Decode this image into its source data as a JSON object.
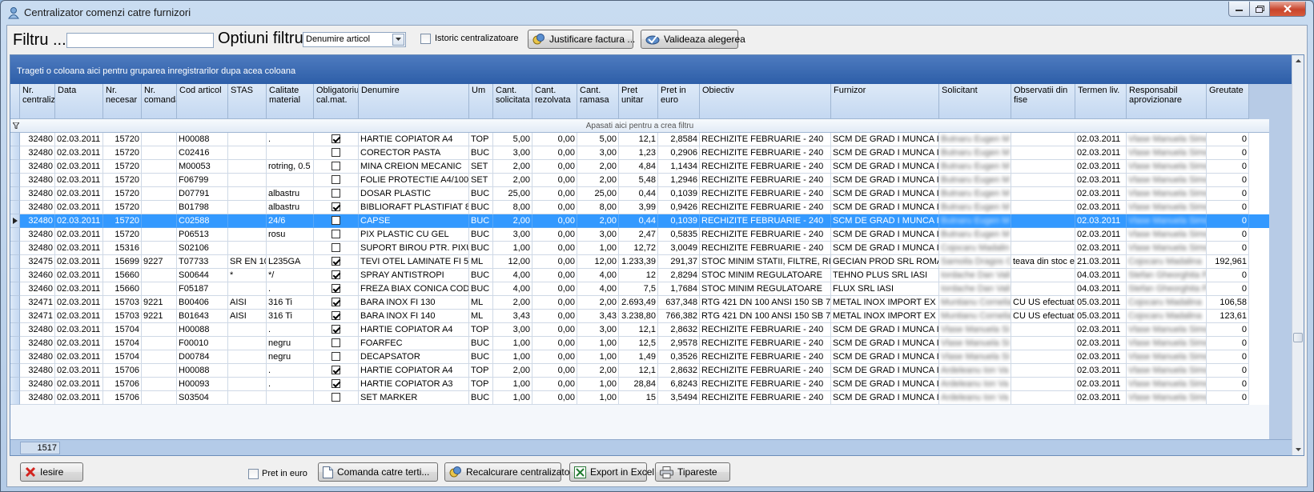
{
  "window": {
    "title": "Centralizator comenzi catre furnizori"
  },
  "toolbar": {
    "filter_label": "Filtru ...",
    "filter_value": "",
    "options_label": "Optiuni filtru",
    "options_selected": "Denumire articol",
    "history_label": "Istoric centralizatoare",
    "justify_label": "Justificare factura ...",
    "validate_label": "Valideaza alegerea"
  },
  "grid": {
    "group_hint": "Trageti o coloana aici pentru gruparea inregistrarilor dupa acea coloana",
    "filter_hint": "Apasati aici pentru a  crea filtru",
    "columns": [
      "Nr. centralizator",
      "Data",
      "Nr. necesar",
      "Nr. comanda",
      "Cod articol",
      "STAS",
      "Calitate material",
      "Obligatoriu cal.mat.",
      "Denumire",
      "Um",
      "Cant. solicitata",
      "Cant. rezolvata",
      "Cant. ramasa",
      "Pret unitar",
      "Pret in euro",
      "Obiectiv",
      "Furnizor",
      "Solicitant",
      "Observatii din fise",
      "Termen liv.",
      "Responsabil aprovizionare",
      "Greutate"
    ],
    "rows": [
      {
        "nr": "32480",
        "data": "02.03.2011",
        "nec": "15720",
        "com": "",
        "cod": "H00088",
        "stas": "",
        "cal": ".",
        "obl": true,
        "den": "HARTIE COPIATOR A4",
        "um": "TOP",
        "sol": "5,00",
        "rez": "0,00",
        "ram": "5,00",
        "pu": "12,1",
        "pe": "2,8584",
        "obi": "RECHIZITE FEBRUARIE - 240",
        "fur": "SCM DE GRAD I MUNCA I",
        "sli": "Butnaru Eugen M",
        "obs": "",
        "ter": "02.03.2011",
        "res": "Vlase Manuela Simona",
        "gre": "0"
      },
      {
        "nr": "32480",
        "data": "02.03.2011",
        "nec": "15720",
        "com": "",
        "cod": "C02416",
        "stas": "",
        "cal": "",
        "obl": false,
        "den": "CORECTOR PASTA",
        "um": "BUC",
        "sol": "3,00",
        "rez": "0,00",
        "ram": "3,00",
        "pu": "1,23",
        "pe": "0,2906",
        "obi": "RECHIZITE FEBRUARIE - 240",
        "fur": "SCM DE GRAD I MUNCA I",
        "sli": "Butnaru Eugen M",
        "obs": "",
        "ter": "02.03.2011",
        "res": "Vlase Manuela Simona",
        "gre": "0"
      },
      {
        "nr": "32480",
        "data": "02.03.2011",
        "nec": "15720",
        "com": "",
        "cod": "M00053",
        "stas": "",
        "cal": "rotring, 0.5 m",
        "obl": false,
        "den": "MINA CREION MECANIC",
        "um": "SET",
        "sol": "2,00",
        "rez": "0,00",
        "ram": "2,00",
        "pu": "4,84",
        "pe": "1,1434",
        "obi": "RECHIZITE FEBRUARIE - 240",
        "fur": "SCM DE GRAD I MUNCA I",
        "sli": "Butnaru Eugen M",
        "obs": "",
        "ter": "02.03.2011",
        "res": "Vlase Manuela Simona",
        "gre": "0"
      },
      {
        "nr": "32480",
        "data": "02.03.2011",
        "nec": "15720",
        "com": "",
        "cod": "F06799",
        "stas": "",
        "cal": "",
        "obl": false,
        "den": "FOLIE PROTECTIE A4/100",
        "um": "SET",
        "sol": "2,00",
        "rez": "0,00",
        "ram": "2,00",
        "pu": "5,48",
        "pe": "1,2946",
        "obi": "RECHIZITE FEBRUARIE - 240",
        "fur": "SCM DE GRAD I MUNCA I",
        "sli": "Butnaru Eugen M",
        "obs": "",
        "ter": "02.03.2011",
        "res": "Vlase Manuela Simona",
        "gre": "0"
      },
      {
        "nr": "32480",
        "data": "02.03.2011",
        "nec": "15720",
        "com": "",
        "cod": "D07791",
        "stas": "",
        "cal": "albastru",
        "obl": false,
        "den": "DOSAR PLASTIC",
        "um": "BUC",
        "sol": "25,00",
        "rez": "0,00",
        "ram": "25,00",
        "pu": "0,44",
        "pe": "0,1039",
        "obi": "RECHIZITE FEBRUARIE - 240",
        "fur": "SCM DE GRAD I MUNCA I",
        "sli": "Butnaru Eugen M",
        "obs": "",
        "ter": "02.03.2011",
        "res": "Vlase Manuela Simona",
        "gre": "0"
      },
      {
        "nr": "32480",
        "data": "02.03.2011",
        "nec": "15720",
        "com": "",
        "cod": "B01798",
        "stas": "",
        "cal": "albastru",
        "obl": true,
        "den": "BIBLIORAFT PLASTIFIAT 8",
        "um": "BUC",
        "sol": "8,00",
        "rez": "0,00",
        "ram": "8,00",
        "pu": "3,99",
        "pe": "0,9426",
        "obi": "RECHIZITE FEBRUARIE - 240",
        "fur": "SCM DE GRAD I MUNCA I",
        "sli": "Butnaru Eugen M",
        "obs": "",
        "ter": "02.03.2011",
        "res": "Vlase Manuela Simona",
        "gre": "0"
      },
      {
        "nr": "32480",
        "data": "02.03.2011",
        "nec": "15720",
        "com": "",
        "cod": "C02588",
        "stas": "",
        "cal": "24/6",
        "obl": false,
        "den": "CAPSE",
        "um": "BUC",
        "sol": "2,00",
        "rez": "0,00",
        "ram": "2,00",
        "pu": "0,44",
        "pe": "0,1039",
        "obi": "RECHIZITE FEBRUARIE - 240",
        "fur": "SCM DE GRAD I MUNCA I",
        "sli": "Butnaru Eugen M",
        "obs": "",
        "ter": "02.03.2011",
        "res": "Vlase Manuela Simona",
        "gre": "0",
        "sel": true
      },
      {
        "nr": "32480",
        "data": "02.03.2011",
        "nec": "15720",
        "com": "",
        "cod": "P06513",
        "stas": "",
        "cal": "rosu",
        "obl": false,
        "den": "PIX PLASTIC CU GEL",
        "um": "BUC",
        "sol": "3,00",
        "rez": "0,00",
        "ram": "3,00",
        "pu": "2,47",
        "pe": "0,5835",
        "obi": "RECHIZITE FEBRUARIE - 240",
        "fur": "SCM DE GRAD I MUNCA I",
        "sli": "Butnaru Eugen M",
        "obs": "",
        "ter": "02.03.2011",
        "res": "Vlase Manuela Simona",
        "gre": "0"
      },
      {
        "nr": "32480",
        "data": "02.03.2011",
        "nec": "15316",
        "com": "",
        "cod": "S02106",
        "stas": "",
        "cal": "",
        "obl": false,
        "den": "SUPORT BIROU PTR. PIXU",
        "um": "BUC",
        "sol": "1,00",
        "rez": "0,00",
        "ram": "1,00",
        "pu": "12,72",
        "pe": "3,0049",
        "obi": "RECHIZITE FEBRUARIE - 240",
        "fur": "SCM DE GRAD I MUNCA I",
        "sli": "Cojocaru Madalin",
        "obs": "",
        "ter": "02.03.2011",
        "res": "Vlase Manuela Simona",
        "gre": "0"
      },
      {
        "nr": "32475",
        "data": "02.03.2011",
        "nec": "15699",
        "com": "9227",
        "cod": "T07733",
        "stas": "SR EN 10",
        "cal": "L235GA",
        "obl": true,
        "den": "TEVI OTEL LAMINATE FI 5",
        "um": "ML",
        "sol": "12,00",
        "rez": "0,00",
        "ram": "12,00",
        "pu": "1.233,39",
        "pe": "291,37",
        "obi": "STOC MINIM STATII, FILTRE, RI",
        "fur": "GECIAN PROD SRL ROMA",
        "sli": "Samoila Dragos C",
        "obs": "teava din stoc e",
        "ter": "21.03.2011",
        "res": "Cojocaru Madalina",
        "gre": "192,961"
      },
      {
        "nr": "32460",
        "data": "02.03.2011",
        "nec": "15660",
        "com": "",
        "cod": "S00644",
        "stas": "*",
        "cal": "*/",
        "obl": true,
        "den": "SPRAY ANTISTROPI",
        "um": "BUC",
        "sol": "4,00",
        "rez": "0,00",
        "ram": "4,00",
        "pu": "12",
        "pe": "2,8294",
        "obi": "STOC MINIM REGULATOARE",
        "fur": "TEHNO PLUS SRL IASI",
        "sli": "Iordache Dan Vali",
        "obs": "",
        "ter": "04.03.2011",
        "res": "Stefan Gheorghita Fl",
        "gre": "0"
      },
      {
        "nr": "32460",
        "data": "02.03.2011",
        "nec": "15660",
        "com": "",
        "cod": "F05187",
        "stas": "",
        "cal": ".",
        "obl": true,
        "den": "FREZA BIAX CONICA COD",
        "um": "BUC",
        "sol": "4,00",
        "rez": "0,00",
        "ram": "4,00",
        "pu": "7,5",
        "pe": "1,7684",
        "obi": "STOC MINIM REGULATOARE",
        "fur": "FLUX SRL IASI",
        "sli": "Iordache Dan Vali",
        "obs": "",
        "ter": "04.03.2011",
        "res": "Stefan Gheorghita Fl",
        "gre": "0"
      },
      {
        "nr": "32471",
        "data": "02.03.2011",
        "nec": "15703",
        "com": "9221",
        "cod": "B00406",
        "stas": "AISI",
        "cal": "316 Ti",
        "obl": true,
        "den": "BARA INOX FI 130",
        "um": "ML",
        "sol": "2,00",
        "rez": "0,00",
        "ram": "2,00",
        "pu": "2.693,49",
        "pe": "637,348",
        "obi": "RTG 421 DN 100 ANSI 150 SB 7",
        "fur": "METAL INOX IMPORT EX",
        "sli": "Muntianu Cornelia",
        "obs": "CU US efectuat",
        "ter": "05.03.2011",
        "res": "Cojocaru Madalina",
        "gre": "106,58"
      },
      {
        "nr": "32471",
        "data": "02.03.2011",
        "nec": "15703",
        "com": "9221",
        "cod": "B01643",
        "stas": "AISI",
        "cal": "316 Ti",
        "obl": true,
        "den": "BARA INOX FI 140",
        "um": "ML",
        "sol": "3,43",
        "rez": "0,00",
        "ram": "3,43",
        "pu": "3.238,80",
        "pe": "766,382",
        "obi": "RTG 421 DN 100 ANSI 150 SB 7",
        "fur": "METAL INOX IMPORT EX",
        "sli": "Muntianu Cornelia",
        "obs": "CU US efectuat",
        "ter": "05.03.2011",
        "res": "Cojocaru Madalina",
        "gre": "123,61"
      },
      {
        "nr": "32480",
        "data": "02.03.2011",
        "nec": "15704",
        "com": "",
        "cod": "H00088",
        "stas": "",
        "cal": ".",
        "obl": true,
        "den": "HARTIE COPIATOR A4",
        "um": "TOP",
        "sol": "3,00",
        "rez": "0,00",
        "ram": "3,00",
        "pu": "12,1",
        "pe": "2,8632",
        "obi": "RECHIZITE FEBRUARIE - 240",
        "fur": "SCM DE GRAD I MUNCA I",
        "sli": "Vlase Manuela Si",
        "obs": "",
        "ter": "02.03.2011",
        "res": "Vlase Manuela Simona",
        "gre": "0"
      },
      {
        "nr": "32480",
        "data": "02.03.2011",
        "nec": "15704",
        "com": "",
        "cod": "F00010",
        "stas": "",
        "cal": "negru",
        "obl": false,
        "den": "FOARFEC",
        "um": "BUC",
        "sol": "1,00",
        "rez": "0,00",
        "ram": "1,00",
        "pu": "12,5",
        "pe": "2,9578",
        "obi": "RECHIZITE FEBRUARIE - 240",
        "fur": "SCM DE GRAD I MUNCA I",
        "sli": "Vlase Manuela Si",
        "obs": "",
        "ter": "02.03.2011",
        "res": "Vlase Manuela Simona",
        "gre": "0"
      },
      {
        "nr": "32480",
        "data": "02.03.2011",
        "nec": "15704",
        "com": "",
        "cod": "D00784",
        "stas": "",
        "cal": "negru",
        "obl": false,
        "den": "DECAPSATOR",
        "um": "BUC",
        "sol": "1,00",
        "rez": "0,00",
        "ram": "1,00",
        "pu": "1,49",
        "pe": "0,3526",
        "obi": "RECHIZITE FEBRUARIE - 240",
        "fur": "SCM DE GRAD I MUNCA I",
        "sli": "Vlase Manuela Si",
        "obs": "",
        "ter": "02.03.2011",
        "res": "Vlase Manuela Simona",
        "gre": "0"
      },
      {
        "nr": "32480",
        "data": "02.03.2011",
        "nec": "15706",
        "com": "",
        "cod": "H00088",
        "stas": "",
        "cal": ".",
        "obl": true,
        "den": "HARTIE COPIATOR A4",
        "um": "TOP",
        "sol": "2,00",
        "rez": "0,00",
        "ram": "2,00",
        "pu": "12,1",
        "pe": "2,8632",
        "obi": "RECHIZITE FEBRUARIE - 240",
        "fur": "SCM DE GRAD I MUNCA I",
        "sli": "Ardeleanu Ion Va",
        "obs": "",
        "ter": "02.03.2011",
        "res": "Vlase Manuela Simona",
        "gre": "0"
      },
      {
        "nr": "32480",
        "data": "02.03.2011",
        "nec": "15706",
        "com": "",
        "cod": "H00093",
        "stas": "",
        "cal": ".",
        "obl": true,
        "den": "HARTIE COPIATOR A3",
        "um": "TOP",
        "sol": "1,00",
        "rez": "0,00",
        "ram": "1,00",
        "pu": "28,84",
        "pe": "6,8243",
        "obi": "RECHIZITE FEBRUARIE - 240",
        "fur": "SCM DE GRAD I MUNCA I",
        "sli": "Ardeleanu Ion Va",
        "obs": "",
        "ter": "02.03.2011",
        "res": "Vlase Manuela Simona",
        "gre": "0"
      },
      {
        "nr": "32480",
        "data": "02.03.2011",
        "nec": "15706",
        "com": "",
        "cod": "S03504",
        "stas": "",
        "cal": "",
        "obl": false,
        "den": "SET MARKER",
        "um": "BUC",
        "sol": "1,00",
        "rez": "0,00",
        "ram": "1,00",
        "pu": "15",
        "pe": "3,5494",
        "obi": "RECHIZITE FEBRUARIE - 240",
        "fur": "SCM DE GRAD I MUNCA I",
        "sli": "Ardeleanu Ion Va",
        "obs": "",
        "ter": "02.03.2011",
        "res": "Vlase Manuela Simona",
        "gre": "0"
      }
    ],
    "record_count": "1517"
  },
  "bottom": {
    "exit_label": "Iesire",
    "euro_label": "Pret in euro",
    "order_label": "Comanda catre terti...",
    "recalc_label": "Recalcurare centralizator",
    "export_label": "Export in Excel",
    "print_label": "Tipareste"
  }
}
